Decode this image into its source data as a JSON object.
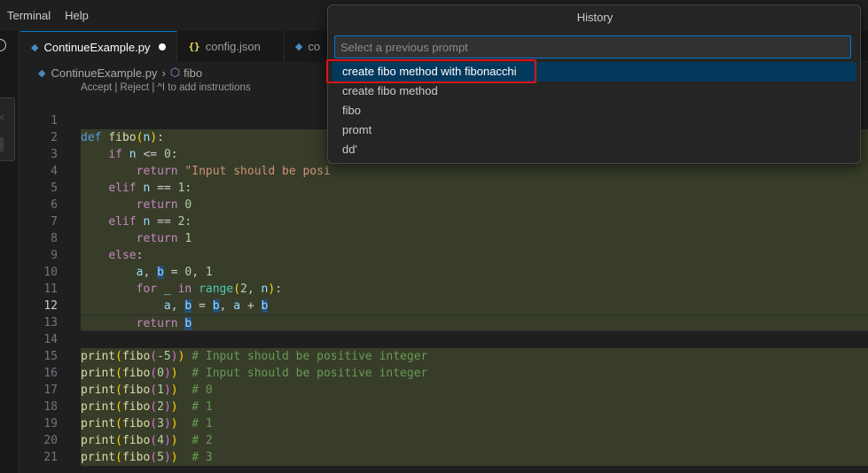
{
  "menu": [
    "Terminal",
    "Help"
  ],
  "tabs": [
    {
      "label": "ContinueExample.py",
      "icon": "python-icon",
      "active": true,
      "modified": true
    },
    {
      "label": "config.json",
      "icon": "json-icon",
      "active": false
    },
    {
      "label": "co",
      "icon": "python-icon",
      "active": false
    }
  ],
  "breadcrumb": {
    "file": "ContinueExample.py",
    "symbol": "fibo"
  },
  "codelens": "Accept | Reject | ^I to add instructions",
  "editor": {
    "current_line": 12,
    "lines": [
      {
        "n": "1"
      },
      {
        "n": "2"
      },
      {
        "n": "3"
      },
      {
        "n": "4"
      },
      {
        "n": "5"
      },
      {
        "n": "6"
      },
      {
        "n": "7"
      },
      {
        "n": "8"
      },
      {
        "n": "9"
      },
      {
        "n": "10"
      },
      {
        "n": "11"
      },
      {
        "n": "12"
      },
      {
        "n": "13"
      },
      {
        "n": "14"
      },
      {
        "n": "15"
      },
      {
        "n": "16"
      },
      {
        "n": "17"
      },
      {
        "n": "18"
      },
      {
        "n": "19"
      },
      {
        "n": "20"
      },
      {
        "n": "21"
      }
    ],
    "text": {
      "def": "def",
      "fibo": "fibo",
      "n": "n",
      "if": "if",
      "elif": "elif",
      "else": "else",
      "return": "return",
      "for": "for",
      "in": "in",
      "range": "range",
      "print": "print",
      "a": "a",
      "b": "b",
      "underscore": "_",
      "str1": "\"Input should be posi",
      "cmt_neg": "# Input should be positive integer",
      "c0": "# 0",
      "c1": "# 1",
      "c2": "# 2",
      "c3": "# 3",
      "nums": {
        "zero": "0",
        "one": "1",
        "two": "2",
        "neg5": "-5",
        "three": "3",
        "four": "4",
        "five": "5"
      }
    }
  },
  "history": {
    "title": "History",
    "placeholder": "Select a previous prompt",
    "items": [
      "create fibo method with fibonacchi",
      "create fibo method",
      "fibo",
      "promt",
      "dd'"
    ],
    "selected_index": 0
  },
  "colors": {
    "accent": "#0078d4",
    "highlight_box": "#e0121b",
    "diff_added_bg": "#373d29"
  }
}
